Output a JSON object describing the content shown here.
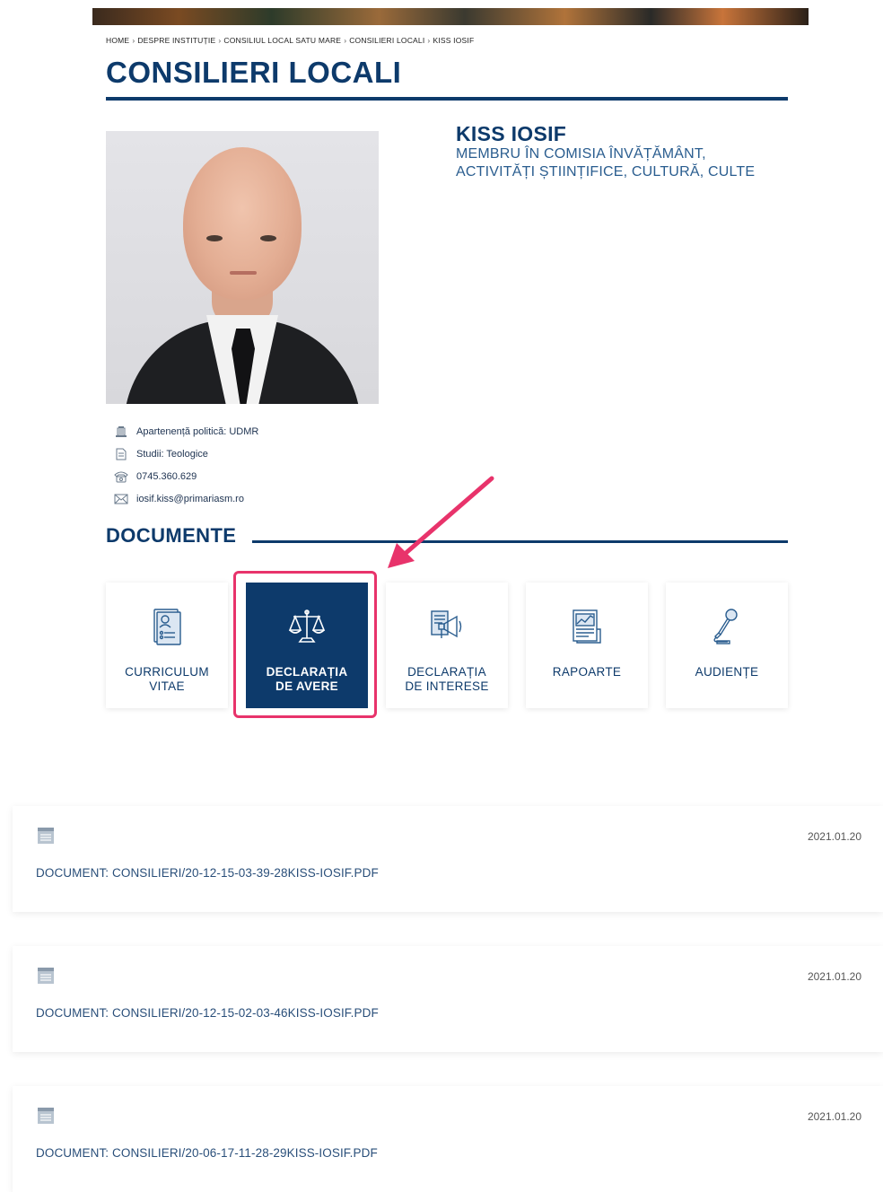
{
  "breadcrumb": {
    "items": [
      "HOME",
      "DESPRE INSTITUȚIE",
      "CONSILIUL LOCAL SATU MARE",
      "CONSILIERI LOCALI",
      "KISS IOSIF"
    ],
    "separator": "›"
  },
  "page": {
    "title": "CONSILIERI LOCALI"
  },
  "member": {
    "name": "KISS IOSIF",
    "role_line1": "MEMBRU ÎN COMISIA ÎNVĂȚĂMÂNT,",
    "role_line2": "ACTIVITĂȚI ȘTIINȚIFICE, CULTURĂ, CULTE",
    "info": [
      {
        "icon": "building-icon",
        "text": "Apartenență politică: UDMR"
      },
      {
        "icon": "document-icon",
        "text": "Studii: Teologice"
      },
      {
        "icon": "phone-icon",
        "text": "0745.360.629"
      },
      {
        "icon": "envelope-icon",
        "text": "iosif.kiss@primariasm.ro"
      }
    ]
  },
  "documents": {
    "title": "DOCUMENTE",
    "cards": [
      {
        "line1": "CURRICULUM",
        "line2": "VITAE",
        "icon": "cv-icon",
        "active": false
      },
      {
        "line1": "DECLARAȚIA",
        "line2": "DE AVERE",
        "icon": "scales-icon",
        "active": true
      },
      {
        "line1": "DECLARAȚIA",
        "line2": "DE INTERESE",
        "icon": "megaphone-document-icon",
        "active": false
      },
      {
        "line1": "RAPOARTE",
        "line2": "",
        "icon": "report-icon",
        "active": false
      },
      {
        "line1": "AUDIENȚE",
        "line2": "",
        "icon": "microphone-icon",
        "active": false
      }
    ],
    "list": [
      {
        "date": "2021.01.20",
        "name": "DOCUMENT: CONSILIERI/20-12-15-03-39-28KISS-IOSIF.PDF"
      },
      {
        "date": "2021.01.20",
        "name": "DOCUMENT: CONSILIERI/20-12-15-02-03-46KISS-IOSIF.PDF"
      },
      {
        "date": "2021.01.20",
        "name": "DOCUMENT: CONSILIERI/20-06-17-11-28-29KISS-IOSIF.PDF"
      }
    ]
  },
  "colors": {
    "brand": "#0d3a6b",
    "highlight": "#e8336b"
  }
}
